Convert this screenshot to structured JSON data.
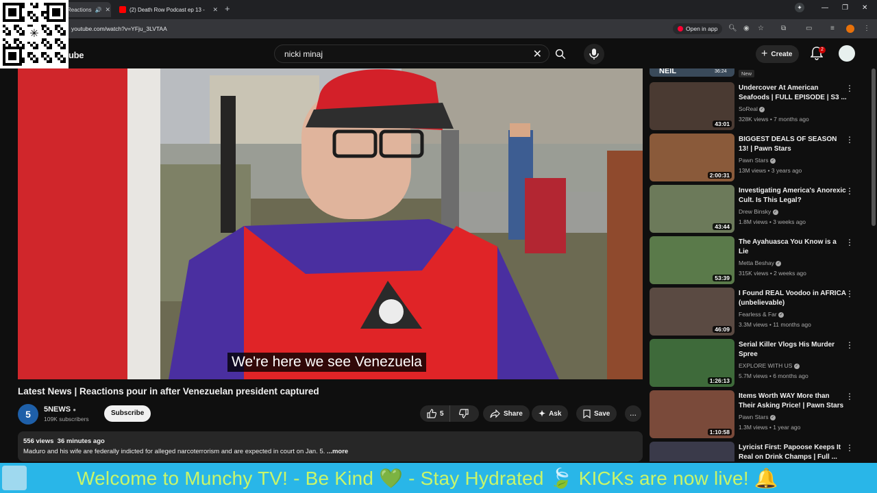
{
  "browser": {
    "tabs": [
      {
        "label": "Reactions"
      },
      {
        "label": "(2) Death Row Podcast ep 13 -"
      }
    ],
    "new_tab": "+",
    "url": "youtube.com/watch?v=YFju_3LVTAA",
    "open_in_app": "Open in app"
  },
  "header": {
    "logo": "ube",
    "search_value": "nicki minaj",
    "create_label": "Create",
    "notification_count": "2"
  },
  "video": {
    "subtitle": "We're here we see Venezuela",
    "title": "Latest News | Reactions pour in after Venezuelan president captured",
    "channel": "5NEWS",
    "channel_initial": "5",
    "subscribers": "109K subscribers",
    "subscribe_label": "Subscribe",
    "likes": "5",
    "share_label": "Share",
    "ask_label": "Ask",
    "save_label": "Save",
    "more_label": "...",
    "views": "556 views",
    "posted": "36 minutes ago",
    "description": "Maduro and his wife are federally indicted for alleged narcoterrorism and are expected in court on Jan. 5.",
    "description_more": " ...more"
  },
  "sidebar": {
    "top_partial_title": "NEIL",
    "top_partial_duration": "36:24",
    "new_badge": "New",
    "items": [
      {
        "title": "Undercover At American Seafoods | FULL EPISODE | S3 ...",
        "channel": "SoReal",
        "meta": "328K views • 7 months ago",
        "duration": "43:01",
        "color": "#4a3a32"
      },
      {
        "title": "BIGGEST DEALS OF SEASON 13! | Pawn Stars",
        "channel": "Pawn Stars",
        "meta": "13M views • 3 years ago",
        "duration": "2:00:31",
        "color": "#8a5a3a"
      },
      {
        "title": "Investigating America's Anorexic Cult. Is This Legal?",
        "channel": "Drew Binsky",
        "meta": "1.8M views • 3 weeks ago",
        "duration": "43:44",
        "color": "#6c7a5a"
      },
      {
        "title": "The Ayahuasca You Know is a Lie",
        "channel": "Metta Beshay",
        "meta": "315K views • 2 weeks ago",
        "duration": "53:39",
        "color": "#5a7a4a"
      },
      {
        "title": "I Found REAL Voodoo in AFRICA (unbelievable)",
        "channel": "Fearless & Far",
        "meta": "3.3M views • 11 months ago",
        "duration": "46:09",
        "color": "#5a4a42"
      },
      {
        "title": "Serial Killer Vlogs His Murder Spree",
        "channel": "EXPLORE WITH US",
        "meta": "5.7M views • 6 months ago",
        "duration": "1:26:13",
        "color": "#3e6a3a"
      },
      {
        "title": "Items Worth WAY More than Their Asking Price! | Pawn Stars",
        "channel": "Pawn Stars",
        "meta": "1.3M views • 1 year ago",
        "duration": "1:10:58",
        "color": "#7a4a3a"
      },
      {
        "title": "Lyricist First: Papoose Keeps It Real on Drink Champs | Full ...",
        "channel": "",
        "meta": "",
        "duration": "",
        "color": "#3a3a4a"
      }
    ]
  },
  "banner": {
    "text": "Welcome to Munchy TV!  - Be Kind  💚  - Stay Hydrated  🍃  KICKs are now live!  🔔"
  }
}
